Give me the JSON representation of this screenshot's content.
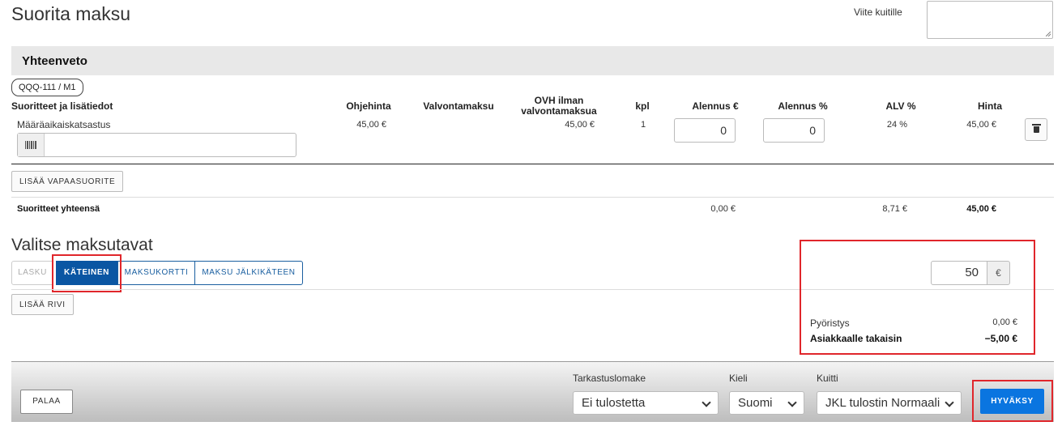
{
  "header": {
    "title": "Suorita maksu",
    "reference_label": "Viite kuitille",
    "reference_value": ""
  },
  "summary": {
    "title": "Yhteenveto",
    "vehicle_badge": "QQQ-111 / M1",
    "columns": {
      "services": "Suoritteet ja lisätiedot",
      "list_price": "Ohjehinta",
      "supervision_fee": "Valvontamaksu",
      "ovh_line1": "OVH ilman",
      "ovh_line2": "valvontamaksua",
      "qty": "kpl",
      "discount_eur": "Alennus €",
      "discount_pct": "Alennus %",
      "vat_pct": "ALV %",
      "price": "Hinta"
    },
    "row": {
      "service": "Määräaikaiskatsastus",
      "list_price": "45,00 €",
      "supervision_fee": "",
      "ovh": "45,00 €",
      "qty": "1",
      "discount_eur": "0",
      "discount_pct": "0",
      "vat_pct": "24 %",
      "price": "45,00 €",
      "barcode_value": ""
    },
    "add_free_service_label": "LISÄÄ VAPAASUORITE",
    "totals": {
      "label": "Suoritteet yhteensä",
      "discount": "0,00 €",
      "vat": "8,71 €",
      "total": "45,00 €"
    }
  },
  "payment": {
    "title": "Valitse maksutavat",
    "methods": [
      {
        "label": "LASKU",
        "state": "disabled"
      },
      {
        "label": "KÄTEINEN",
        "state": "active"
      },
      {
        "label": "MAKSUKORTTI",
        "state": "normal"
      },
      {
        "label": "MAKSU JÄLKIKÄTEEN",
        "state": "normal"
      }
    ],
    "add_row_label": "LISÄÄ RIVI",
    "amount": "50",
    "currency": "€",
    "rounding_label": "Pyöristys",
    "rounding_value": "0,00 €",
    "change_label": "Asiakkaalle takaisin",
    "change_value": "−5,00 €"
  },
  "footer": {
    "back_label": "PALAA",
    "inspection_form_label": "Tarkastuslomake",
    "inspection_form_value": "Ei tulostetta",
    "language_label": "Kieli",
    "language_value": "Suomi",
    "receipt_label": "Kuitti",
    "receipt_value": "JKL tulostin Normaali",
    "approve_label": "HYVÄKSY"
  },
  "colors": {
    "primary": "#0a56a3",
    "approve": "#0a75e0",
    "highlight": "#e0262b"
  },
  "icons": {
    "barcode": "barcode-icon",
    "trash": "trash-icon",
    "chevron": "chevron-down-icon"
  }
}
